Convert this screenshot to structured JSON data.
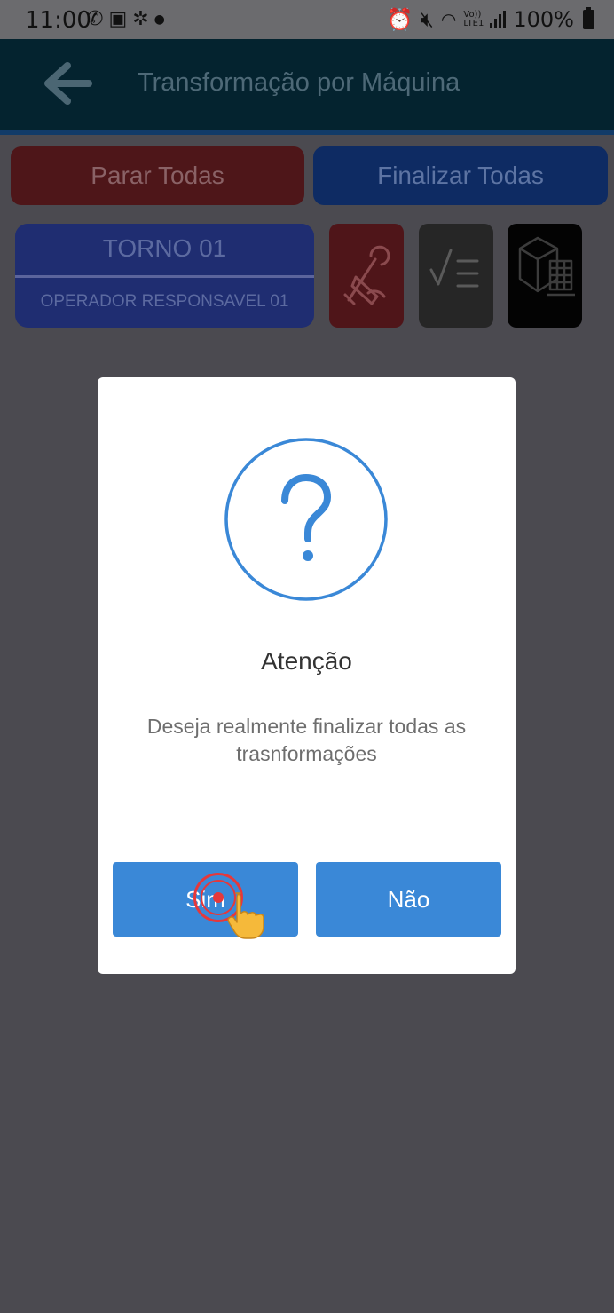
{
  "status_bar": {
    "time": "11:00",
    "left_icons": [
      "whatsapp-icon",
      "cast-icon",
      "fan-icon",
      "dot-icon"
    ],
    "network_label": "Vo)) LTE1",
    "battery": "100%"
  },
  "app_bar": {
    "title": "Transformação por Máquina",
    "back_icon": "back-arrow-icon",
    "background": "#04232f"
  },
  "actions": {
    "stop_all_label": "Parar Todas",
    "finish_all_label": "Finalizar Todas",
    "stop_color": "#c0392b",
    "finish_color": "#1e5bd6"
  },
  "machine": {
    "name": "TORNO 01",
    "operator": "OPERADOR RESPONSAVEL 01",
    "tiles": [
      "tools-icon",
      "checklist-icon",
      "stock-box-icon"
    ]
  },
  "dialog": {
    "icon": "question-icon",
    "title": "Atenção",
    "message": "Deseja realmente finalizar todas as trasnformações",
    "yes_label": "Sim",
    "no_label": "Não",
    "button_color": "#3a88d7"
  }
}
